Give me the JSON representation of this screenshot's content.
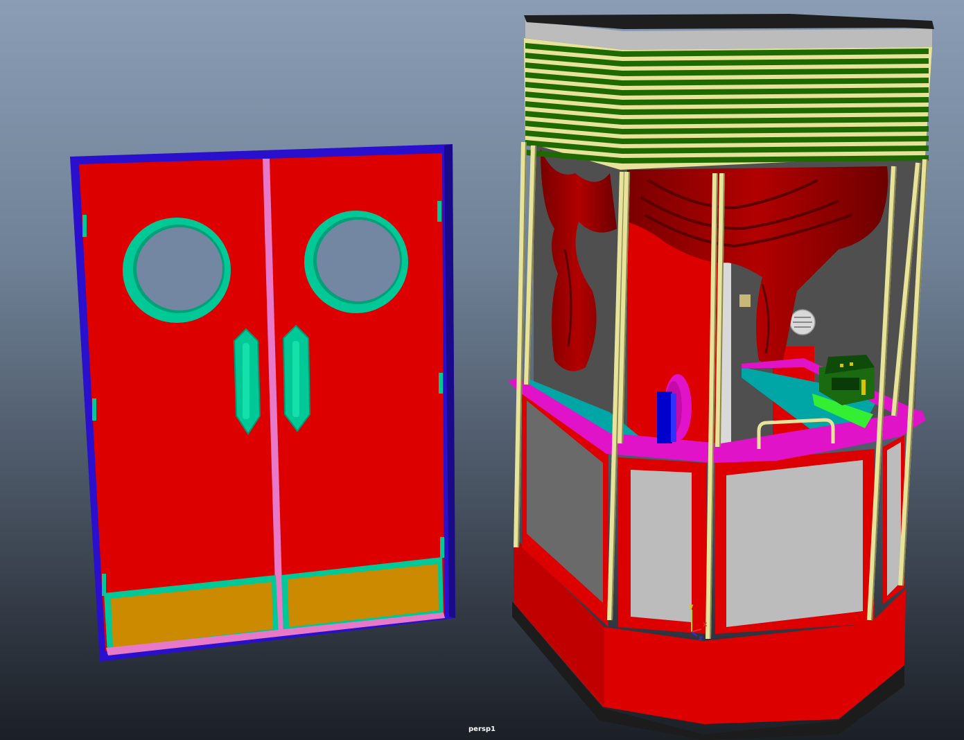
{
  "viewport": {
    "camera_label": "persp1",
    "axis": {
      "y": "y",
      "x": "x",
      "z": "z"
    }
  },
  "colors": {
    "door_red": "#dd0000",
    "frame_blue": "#2a10cc",
    "trim_teal": "#00c896",
    "kick_plate": "#cc8a00",
    "pole_yellow": "#e7e39a",
    "fascia_green": "#1e6a00",
    "counter_magenta": "#e013c8",
    "counter_cyan": "#00a6a6",
    "panel_grey": "#bcbcbc",
    "curtain_red": "#a50000"
  },
  "scene_objects": [
    "double-door",
    "ticket-booth",
    "cash-register",
    "ticket-dispenser",
    "drape-curtain",
    "vent-grille"
  ]
}
